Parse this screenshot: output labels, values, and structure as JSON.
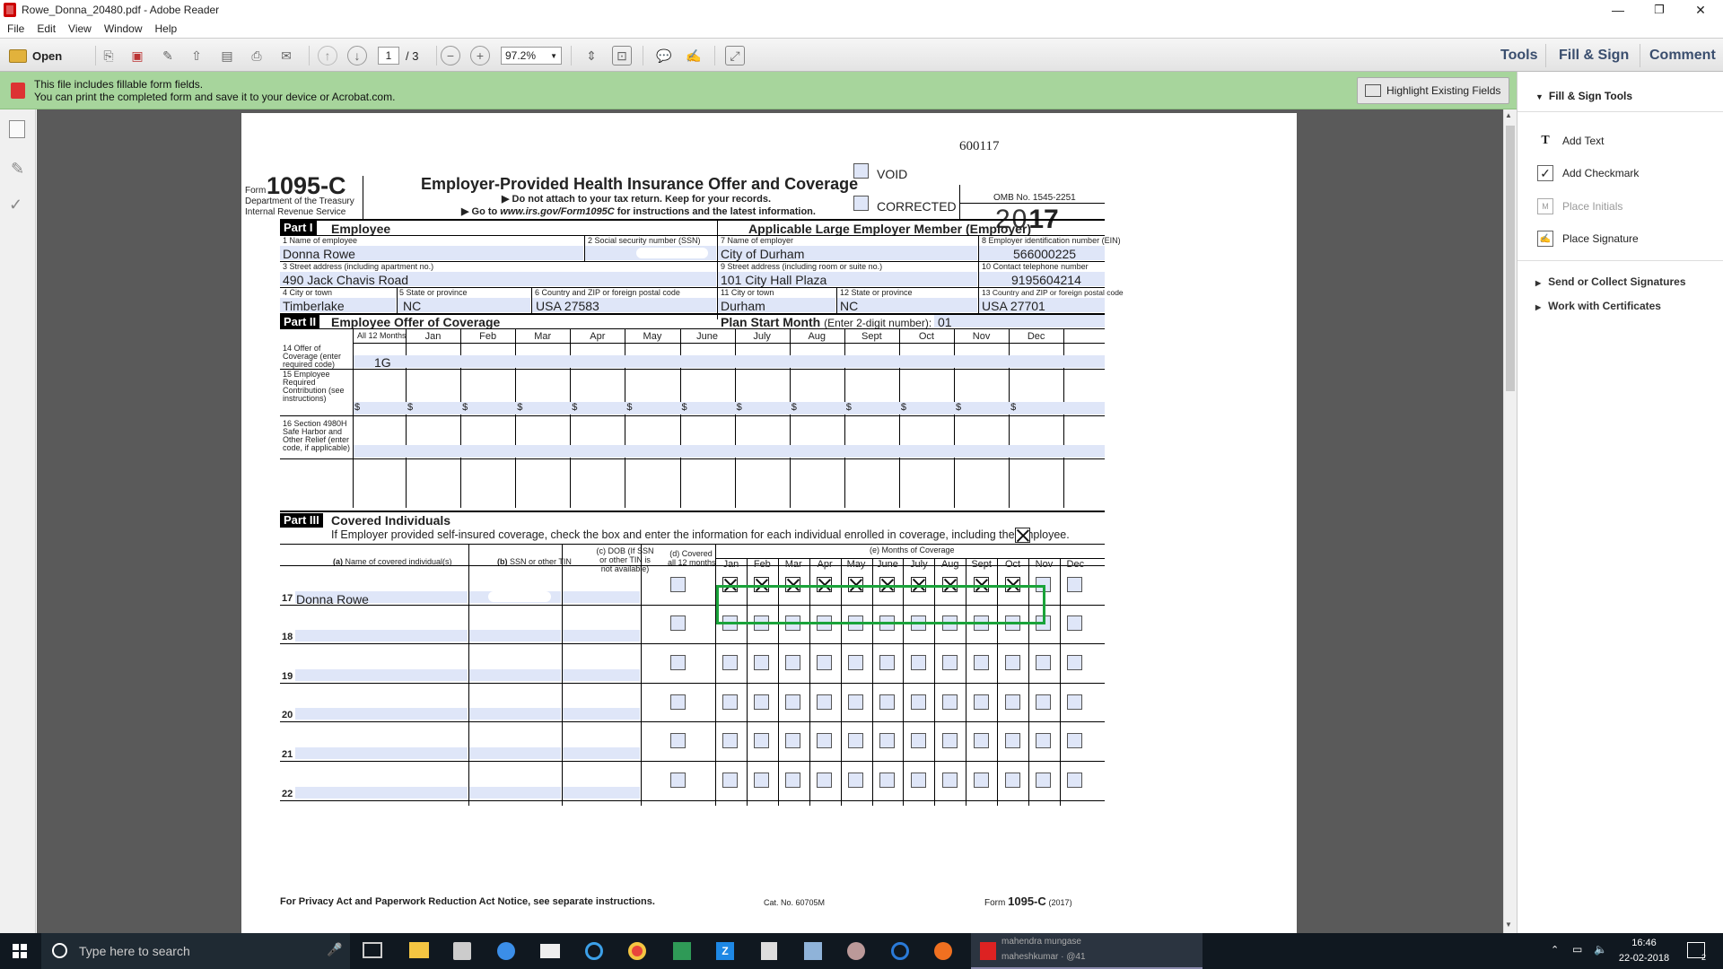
{
  "window": {
    "title": "Rowe_Donna_20480.pdf - Adobe Reader",
    "minimize": "—",
    "restore": "❐",
    "close": "✕"
  },
  "menu": [
    "File",
    "Edit",
    "View",
    "Window",
    "Help"
  ],
  "toolbar": {
    "open": "Open",
    "page_current": "1",
    "page_total": "/ 3",
    "zoom": "97.2%",
    "tools": "Tools",
    "fill_sign": "Fill & Sign",
    "comment": "Comment"
  },
  "notice": {
    "line1": "This file includes fillable form fields.",
    "line2": "You can print the completed form and save it to your device or Acrobat.com.",
    "highlight_button": "Highlight Existing Fields"
  },
  "right_panel": {
    "header": "Fill & Sign Tools",
    "add_text": "Add Text",
    "add_checkmark": "Add Checkmark",
    "place_initials": "Place Initials",
    "place_signature": "Place Signature",
    "send_collect": "Send or Collect Signatures",
    "certificates": "Work with Certificates"
  },
  "form": {
    "code": "600117",
    "form_word": "Form",
    "form_num": "1095-C",
    "dept1": "Department of the Treasury",
    "dept2": "Internal Revenue Service",
    "title": "Employer-Provided Health Insurance Offer and Coverage",
    "sub1": "▶ Do not attach to your tax return. Keep for your records.",
    "sub2_pre": "▶ Go to ",
    "sub2_url": "www.irs.gov/Form1095C",
    "sub2_post": " for instructions and the latest information.",
    "void": "VOID",
    "corrected": "CORRECTED",
    "omb": "OMB No. 1545-2251",
    "year_light": "20",
    "year_bold": "17",
    "part1": "Part I",
    "part1_title": "Employee",
    "employer_heading": "Applicable Large Employer Member (Employer)",
    "l1": "1  Name of employee",
    "l2": "2  Social security number (SSN)",
    "l7": "7  Name of employer",
    "l8": "8  Employer identification number (EIN)",
    "v1": "Donna Rowe",
    "v7": "City of Durham",
    "v8": "566000225",
    "l3": "3  Street address (including apartment no.)",
    "l9": "9  Street address (including room or suite no.)",
    "l10": "10 Contact telephone number",
    "v3": "490 Jack Chavis Road",
    "v9": "101 City Hall Plaza",
    "v10": "9195604214",
    "l4": "4  City or town",
    "l5": "5  State or province",
    "l6": "6 Country and ZIP or foreign postal code",
    "l11": "11 City or town",
    "l12": "12  State or province",
    "l13": "13 Country and ZIP or foreign postal code",
    "v4": "Timberlake",
    "v5": "NC",
    "v6": "USA 27583",
    "v11": "Durham",
    "v12": "NC",
    "v13": "USA 27701",
    "part2": "Part II",
    "part2_title": "Employee Offer of Coverage",
    "plan_start": "Plan Start Month",
    "plan_start_note": "(Enter 2-digit number):",
    "plan_start_val": "01",
    "all12": "All 12 Months",
    "months": [
      "Jan",
      "Feb",
      "Mar",
      "Apr",
      "May",
      "June",
      "July",
      "Aug",
      "Sept",
      "Oct",
      "Nov",
      "Dec"
    ],
    "l14": [
      "14  Offer of",
      "Coverage (enter",
      "required code)"
    ],
    "v14_all": "1G",
    "l15": [
      "15  Employee",
      "Required",
      "Contribution (see",
      "instructions)"
    ],
    "dollar": "$",
    "l16": [
      "16 Section 4980H",
      "Safe Harbor and",
      "Other Relief (enter",
      "code, if applicable)"
    ],
    "part3": "Part III",
    "part3_title": "Covered Individuals",
    "part3_note": "If Employer provided self-insured coverage, check the box and enter the information for each individual enrolled in coverage, including the employee.",
    "ca_pre": "(a)",
    "ca": " Name of covered individual(s)",
    "cb_pre": "(b)",
    "cb": " SSN or other TIN",
    "cc": [
      "(c) DOB (If SSN",
      "or other TIN is",
      "not available)"
    ],
    "cd": [
      "(d) Covered",
      "all 12 months"
    ],
    "ce": "(e) Months of Coverage",
    "months3": [
      "Jan",
      "Feb",
      "Mar",
      "Apr",
      "May",
      "June",
      "July",
      "Aug",
      "Sept",
      "Oct",
      "Nov",
      "Dec"
    ],
    "rows": [
      {
        "num": "17",
        "name": "Donna Rowe",
        "all12": false,
        "checked": [
          true,
          true,
          true,
          true,
          true,
          true,
          true,
          true,
          true,
          true,
          false,
          false
        ]
      },
      {
        "num": "18",
        "name": "",
        "all12": false,
        "checked": [
          false,
          false,
          false,
          false,
          false,
          false,
          false,
          false,
          false,
          false,
          false,
          false
        ]
      },
      {
        "num": "19",
        "name": "",
        "all12": false,
        "checked": [
          false,
          false,
          false,
          false,
          false,
          false,
          false,
          false,
          false,
          false,
          false,
          false
        ]
      },
      {
        "num": "20",
        "name": "",
        "all12": false,
        "checked": [
          false,
          false,
          false,
          false,
          false,
          false,
          false,
          false,
          false,
          false,
          false,
          false
        ]
      },
      {
        "num": "21",
        "name": "",
        "all12": false,
        "checked": [
          false,
          false,
          false,
          false,
          false,
          false,
          false,
          false,
          false,
          false,
          false,
          false
        ]
      },
      {
        "num": "22",
        "name": "",
        "all12": false,
        "checked": [
          false,
          false,
          false,
          false,
          false,
          false,
          false,
          false,
          false,
          false,
          false,
          false
        ]
      }
    ],
    "privacy": "For Privacy Act and Paperwork Reduction Act Notice, see separate instructions.",
    "cat": "Cat. No. 60705M",
    "foot_form": "Form",
    "foot_num": "1095-C",
    "foot_year": "(2017)"
  },
  "highlight_color": "#1aa33a",
  "taskbar": {
    "search": "Type here to search",
    "notify1": "mahendra mungase",
    "notify2": "maheshkumar · @41",
    "time": "16:46",
    "date": "22-02-2018",
    "badge": "2"
  }
}
